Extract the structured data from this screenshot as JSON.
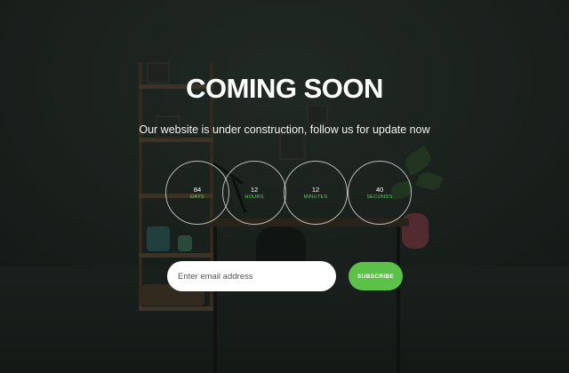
{
  "hero": {
    "title": "COMING SOON",
    "subtitle": "Our website is under construction, follow us for update now"
  },
  "countdown": [
    {
      "value": "84",
      "unit": "DAYS"
    },
    {
      "value": "12",
      "unit": "HOURS"
    },
    {
      "value": "12",
      "unit": "MINUTES"
    },
    {
      "value": "40",
      "unit": "SECONDS"
    }
  ],
  "subscribe_form": {
    "email_placeholder": "Enter email address",
    "button_label": "SUBSCRIBE"
  },
  "colors": {
    "accent": "#5cc149",
    "unit_text": "#5fd35a",
    "overlay": "#1f2622"
  }
}
